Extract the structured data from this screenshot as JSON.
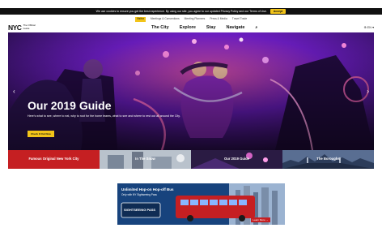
{
  "cookie": {
    "text": "We use cookies to ensure you get the best experience. By using our site, you agree to our updated Privacy Policy and our Terms of Use.",
    "button": "Accept"
  },
  "utility": [
    {
      "label": "Visitor",
      "active": true
    },
    {
      "label": "Meetings & Conventions",
      "active": false
    },
    {
      "label": "Meeting Planners",
      "active": false
    },
    {
      "label": "Press & Media",
      "active": false
    },
    {
      "label": "Travel Trade",
      "active": false
    }
  ],
  "brand": {
    "mark": "NYC",
    "sub1": "The Official",
    "sub2": "Guide"
  },
  "menu": [
    "The City",
    "Explore",
    "Stay",
    "Navigate"
  ],
  "lang": "⊕ EN ▾",
  "hero": {
    "title": "Our 2019 Guide",
    "text": "Here's what to see, where to eat, why to root for the home teams, what to see and where to rest out all around the City.",
    "cta": "Check It Out Now"
  },
  "tiles": [
    {
      "label": "Famous Original New York City"
    },
    {
      "label": "In The Snow"
    },
    {
      "label": "Our 2019 Guide"
    },
    {
      "label": "The Boroughs"
    }
  ],
  "ad": {
    "headline": "Unlimited Hop-on Hop-off Bus",
    "subline": "Only with NY Sightseeing Pass",
    "bus_text": "SIGHTSEEING PASS",
    "learn": "Learn More →"
  }
}
